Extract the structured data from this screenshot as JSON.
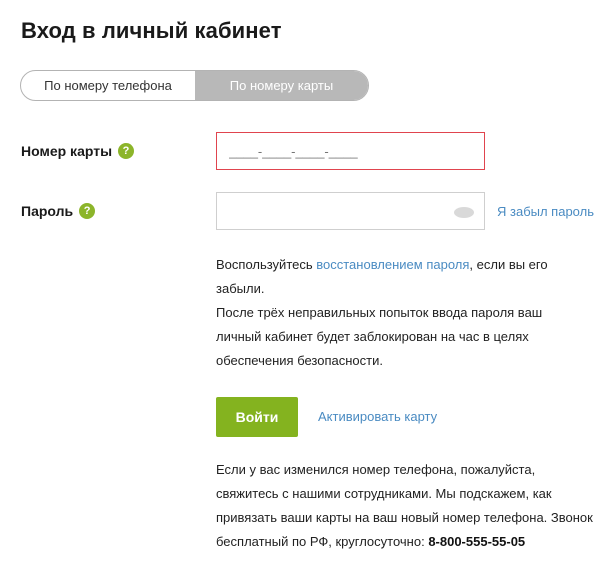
{
  "page": {
    "title": "Вход в личный кабинет"
  },
  "tabs": [
    {
      "label": "По номеру телефона",
      "active": false
    },
    {
      "label": "По номеру карты",
      "active": true
    }
  ],
  "card_field": {
    "label": "Номер карты",
    "help": "?",
    "placeholder": "____-____-____-____",
    "value": ""
  },
  "password_field": {
    "label": "Пароль",
    "help": "?",
    "value": "",
    "icon": "eye-icon",
    "forgot_link": "Я забыл пароль"
  },
  "recovery_info": {
    "prefix": "Воспользуйтесь ",
    "link": "восстановлением пароля",
    "suffix": ", если вы его забыли.",
    "lock_warning": "После трёх неправильных попыток ввода пароля ваш личный кабинет будет заблокирован на час в целях обеспечения безопасности."
  },
  "actions": {
    "login_label": "Войти",
    "activate_label": "Активировать карту"
  },
  "contact_info": {
    "text": "Если у вас изменился номер телефона, пожалуйста, свяжитесь с нашими сотрудниками. Мы подскажем, как привязать ваши карты на ваш новый номер телефона. Звонок бесплатный по РФ, круглосуточно: ",
    "phone": "8-800-555-55-05"
  },
  "colors": {
    "accent_green": "#84b31f",
    "help_green": "#8cb52a",
    "link_blue": "#4a8bc2",
    "error_red": "#e0444e",
    "tab_active_bg": "#b8b8b8"
  }
}
